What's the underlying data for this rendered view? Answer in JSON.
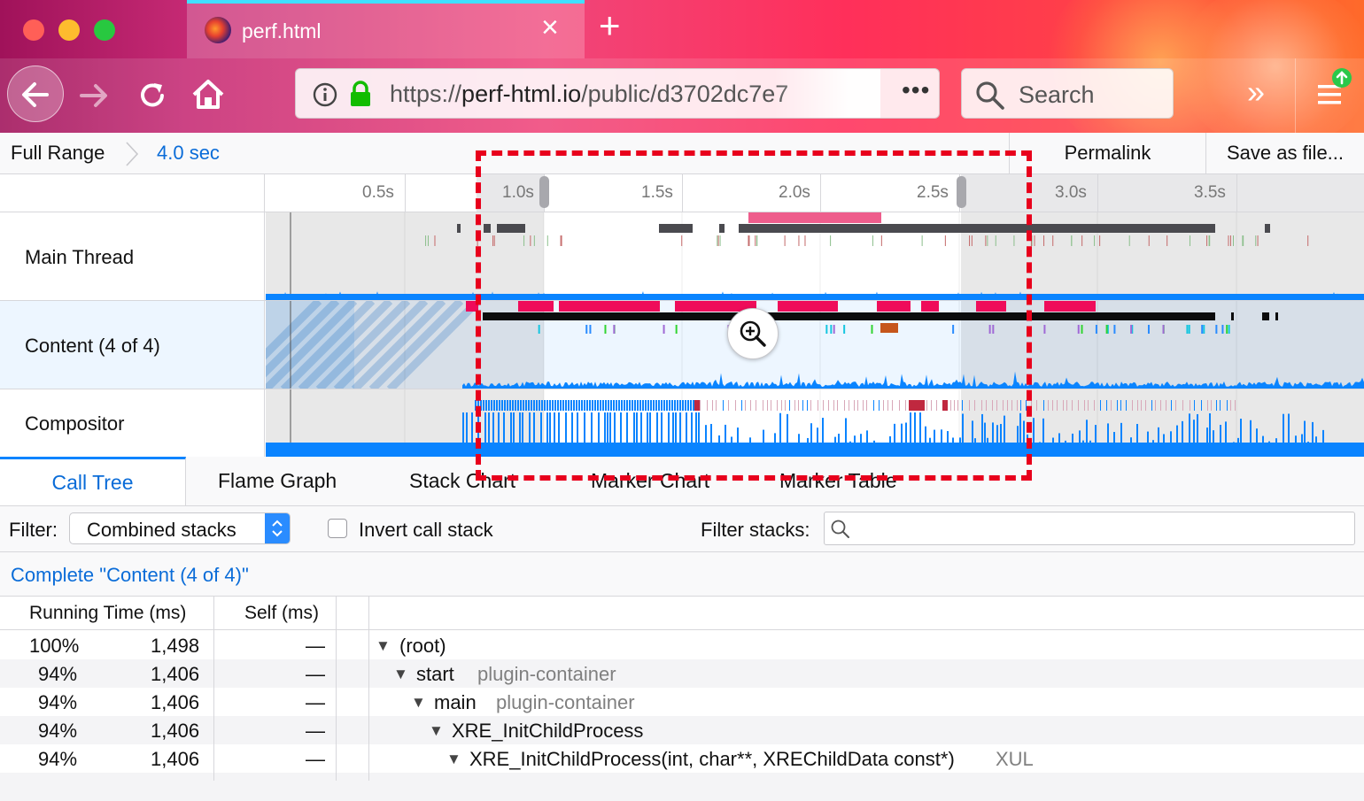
{
  "browser": {
    "tab_title": "perf.html",
    "url_scheme": "https://",
    "url_domain": "perf-html.io",
    "url_path": "/public/d3702dc7e7",
    "search_placeholder": "Search",
    "colors": {
      "tab_highlight": "#40e0ff",
      "traffic_close": "#ff5f57",
      "traffic_min": "#febc2e",
      "traffic_max": "#28c840"
    }
  },
  "header": {
    "breadcrumb_root": "Full Range",
    "breadcrumb_current": "4.0 sec",
    "permalink_label": "Permalink",
    "save_label": "Save as file..."
  },
  "timeline": {
    "ticks": [
      "0.5s",
      "1.0s",
      "1.5s",
      "2.0s",
      "2.5s",
      "3.0s",
      "3.5s"
    ],
    "tracks": [
      "Main Thread",
      "Content (4 of 4)",
      "Compositor"
    ],
    "selected_track": "Content (4 of 4)",
    "selection_range_sec": [
      0.92,
      2.4
    ],
    "zoom_button_icon": "magnifier-plus-icon"
  },
  "panel": {
    "tabs": [
      "Call Tree",
      "Flame Graph",
      "Stack Chart",
      "Marker Chart",
      "Marker Table"
    ],
    "active_tab": "Call Tree",
    "filter_label": "Filter:",
    "filter_value": "Combined stacks",
    "invert_label": "Invert call stack",
    "invert_checked": false,
    "filter_stacks_label": "Filter stacks:",
    "filter_stacks_value": "",
    "thread_crumb": "Complete \"Content (4 of 4)\""
  },
  "call_tree": {
    "columns": {
      "running": "Running Time (ms)",
      "self": "Self (ms)"
    },
    "rows": [
      {
        "pct": "100%",
        "ms": "1,498",
        "self": "—",
        "name": "(root)",
        "lib": "",
        "depth": 0
      },
      {
        "pct": "94%",
        "ms": "1,406",
        "self": "—",
        "name": "start",
        "lib": "plugin-container",
        "depth": 1
      },
      {
        "pct": "94%",
        "ms": "1,406",
        "self": "—",
        "name": "main",
        "lib": "plugin-container",
        "depth": 2
      },
      {
        "pct": "94%",
        "ms": "1,406",
        "self": "—",
        "name": "XRE_InitChildProcess",
        "lib": "",
        "depth": 3
      },
      {
        "pct": "94%",
        "ms": "1,406",
        "self": "—",
        "name": "XRE_InitChildProcess(int, char**, XREChildData const*)",
        "lib": "XUL",
        "depth": 4
      }
    ]
  },
  "annotation": {
    "highlight_color": "#e8001c"
  }
}
